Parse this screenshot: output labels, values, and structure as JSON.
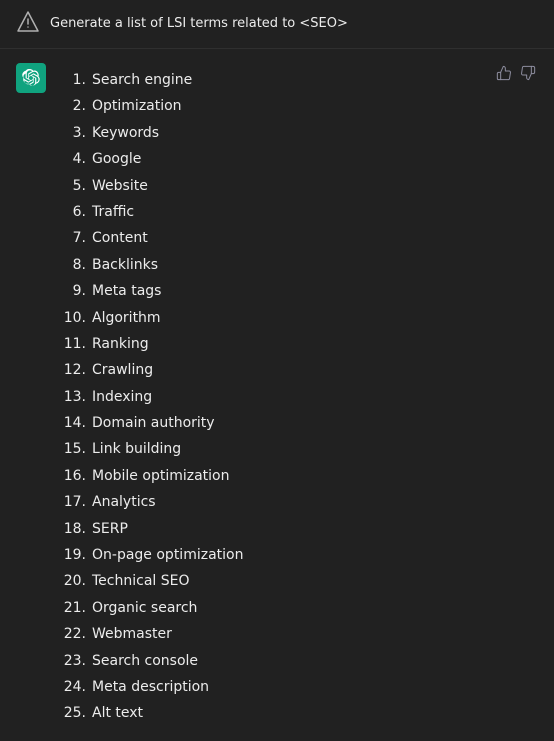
{
  "topbar": {
    "text": "Generate a list of LSI terms related to <SEO>",
    "warning_icon": "triangle-warning-icon"
  },
  "message": {
    "avatar_alt": "ChatGPT logo",
    "items": [
      {
        "number": "1.",
        "text": "Search engine"
      },
      {
        "number": "2.",
        "text": "Optimization"
      },
      {
        "number": "3.",
        "text": "Keywords"
      },
      {
        "number": "4.",
        "text": "Google"
      },
      {
        "number": "5.",
        "text": "Website"
      },
      {
        "number": "6.",
        "text": "Traffic"
      },
      {
        "number": "7.",
        "text": "Content"
      },
      {
        "number": "8.",
        "text": "Backlinks"
      },
      {
        "number": "9.",
        "text": "Meta tags"
      },
      {
        "number": "10.",
        "text": "Algorithm"
      },
      {
        "number": "11.",
        "text": "Ranking"
      },
      {
        "number": "12.",
        "text": "Crawling"
      },
      {
        "number": "13.",
        "text": "Indexing"
      },
      {
        "number": "14.",
        "text": "Domain authority"
      },
      {
        "number": "15.",
        "text": "Link building"
      },
      {
        "number": "16.",
        "text": "Mobile optimization"
      },
      {
        "number": "17.",
        "text": "Analytics"
      },
      {
        "number": "18.",
        "text": "SERP"
      },
      {
        "number": "19.",
        "text": "On-page optimization"
      },
      {
        "number": "20.",
        "text": "Technical SEO"
      },
      {
        "number": "21.",
        "text": "Organic search"
      },
      {
        "number": "22.",
        "text": "Webmaster"
      },
      {
        "number": "23.",
        "text": "Search console"
      },
      {
        "number": "24.",
        "text": "Meta description"
      },
      {
        "number": "25.",
        "text": "Alt text"
      }
    ],
    "thumbup_label": "thumbs-up",
    "thumbdown_label": "thumbs-down"
  }
}
